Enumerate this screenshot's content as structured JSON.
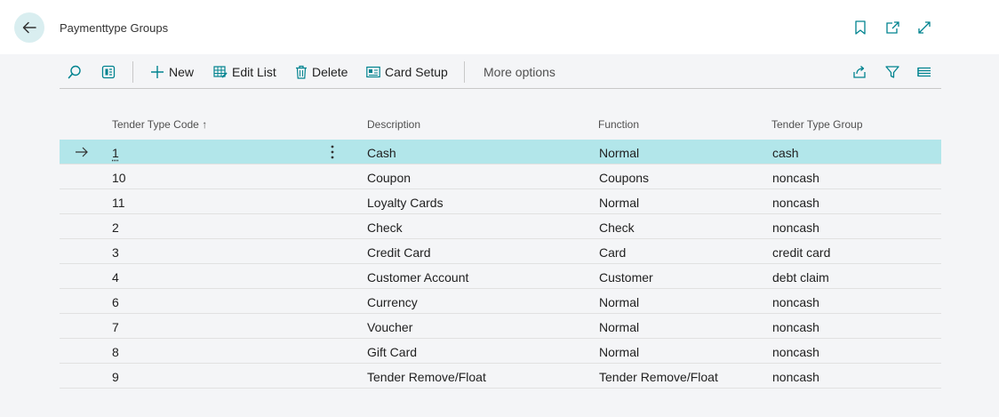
{
  "header": {
    "title": "Paymenttype Groups",
    "icons": [
      "back-arrow-icon",
      "bookmark-icon",
      "open-in-new-window-icon",
      "expand-icon"
    ]
  },
  "toolbar": {
    "new_label": "New",
    "edit_list_label": "Edit List",
    "delete_label": "Delete",
    "card_setup_label": "Card Setup",
    "more_options_label": "More options"
  },
  "table": {
    "columns": {
      "code": "Tender Type Code",
      "description": "Description",
      "function": "Function",
      "group": "Tender Type Group"
    },
    "sort_indicator": "↑",
    "rows": [
      {
        "code": "1",
        "description": "Cash",
        "function": "Normal",
        "group": "cash"
      },
      {
        "code": "10",
        "description": "Coupon",
        "function": "Coupons",
        "group": "noncash"
      },
      {
        "code": "11",
        "description": "Loyalty Cards",
        "function": "Normal",
        "group": "noncash"
      },
      {
        "code": "2",
        "description": "Check",
        "function": "Check",
        "group": "noncash"
      },
      {
        "code": "3",
        "description": "Credit Card",
        "function": "Card",
        "group": "credit card"
      },
      {
        "code": "4",
        "description": "Customer Account",
        "function": "Customer",
        "group": "debt claim"
      },
      {
        "code": "6",
        "description": "Currency",
        "function": "Normal",
        "group": "noncash"
      },
      {
        "code": "7",
        "description": "Voucher",
        "function": "Normal",
        "group": "noncash"
      },
      {
        "code": "8",
        "description": "Gift Card",
        "function": "Normal",
        "group": "noncash"
      },
      {
        "code": "9",
        "description": "Tender Remove/Float",
        "function": "Tender Remove/Float",
        "group": "noncash"
      }
    ]
  },
  "colors": {
    "accent": "#00838f",
    "selected_row": "#b2e6ea",
    "back_button_bg": "#d9eef0"
  }
}
